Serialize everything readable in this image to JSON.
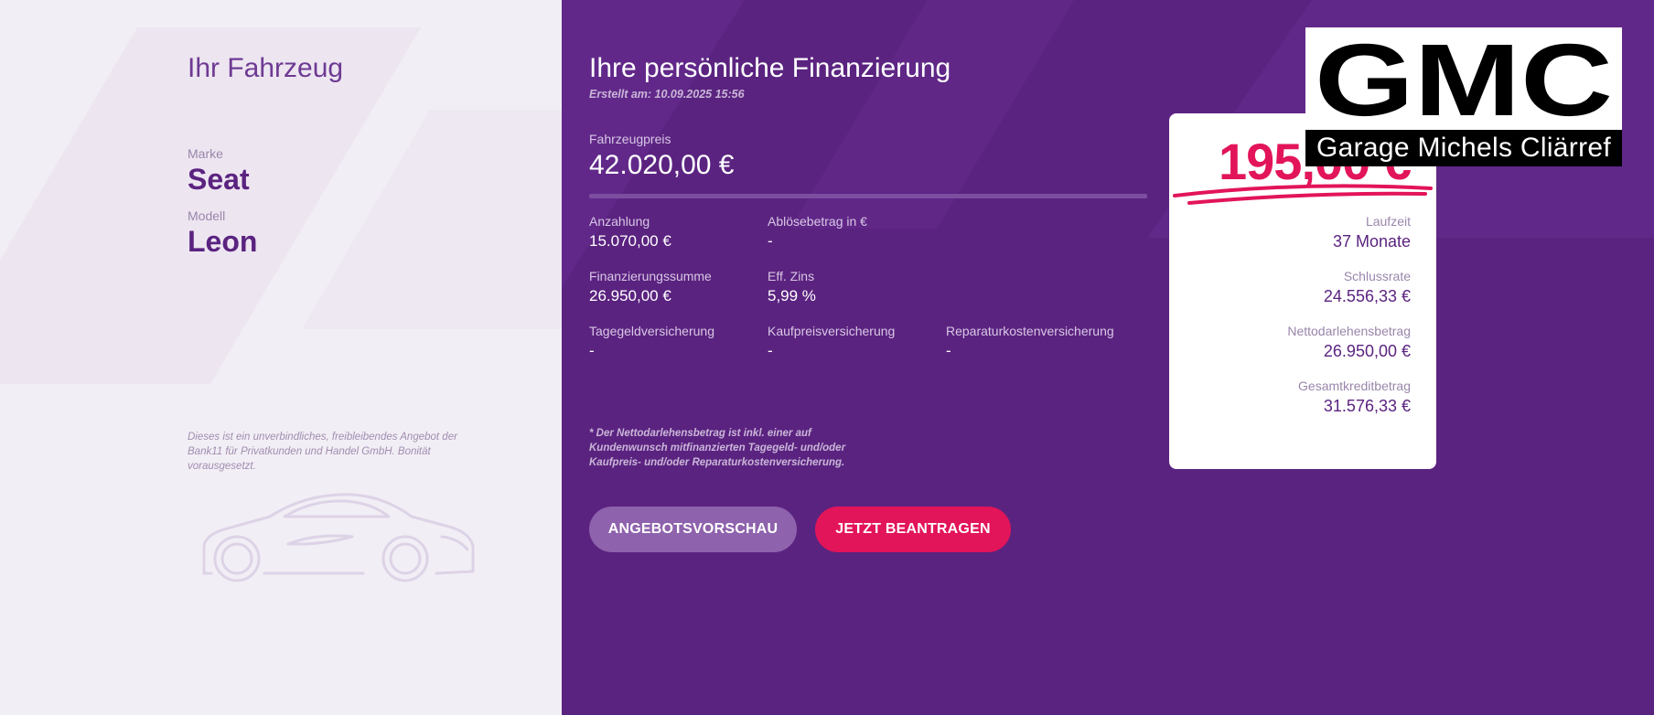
{
  "vehicle": {
    "title": "Ihr Fahrzeug",
    "brand_label": "Marke",
    "brand_value": "Seat",
    "model_label": "Modell",
    "model_value": "Leon",
    "disclaimer": "Dieses ist ein unverbindliches, freibleibendes Angebot der Bank11 für Privatkunden und Handel GmbH. Bonität vorausgesetzt."
  },
  "financing": {
    "title": "Ihre persönliche Finanzierung",
    "created": "Erstellt am: 10.09.2025 15:56",
    "price_label": "Fahrzeugpreis",
    "price_value": "42.020,00 €",
    "items": [
      {
        "label": "Anzahlung",
        "value": "15.070,00 €"
      },
      {
        "label": "Ablösebetrag in €",
        "value": "-"
      },
      {
        "label": "Finanzierungssumme",
        "value": "26.950,00 €"
      },
      {
        "label": "Eff. Zins",
        "value": "5,99 %"
      },
      {
        "label": "Tagegeldversicherung",
        "value": "-"
      },
      {
        "label": "Kaufpreisversicherung",
        "value": "-"
      },
      {
        "label": "Reparaturkostenversicherung",
        "value": "-"
      }
    ],
    "footnote": "* Der Nettodarlehensbetrag ist inkl. einer auf Kundenwunsch mitfinanzierten Tagegeld- und/oder Kaufpreis- und/oder Reparaturkostenversicherung."
  },
  "buttons": {
    "preview": "ANGEBOTSVORSCHAU",
    "apply": "JETZT BEANTRAGEN"
  },
  "rate_card": {
    "monthly_rate": "195,00 €",
    "rows": [
      {
        "label": "Laufzeit",
        "value": "37 Monate"
      },
      {
        "label": "Schlussrate",
        "value": "24.556,33 €"
      },
      {
        "label": "Nettodarlehensbetrag",
        "value": "26.950,00 €"
      },
      {
        "label": "Gesamtkreditbetrag",
        "value": "31.576,33 €"
      }
    ]
  },
  "logo": {
    "mark": "GMC",
    "tagline": "Garage Michels Cliärref"
  },
  "colors": {
    "primary_purple": "#5b2380",
    "accent_pink": "#e2145a",
    "preview_button": "#8e62ac",
    "left_background": "#f2eef5"
  }
}
